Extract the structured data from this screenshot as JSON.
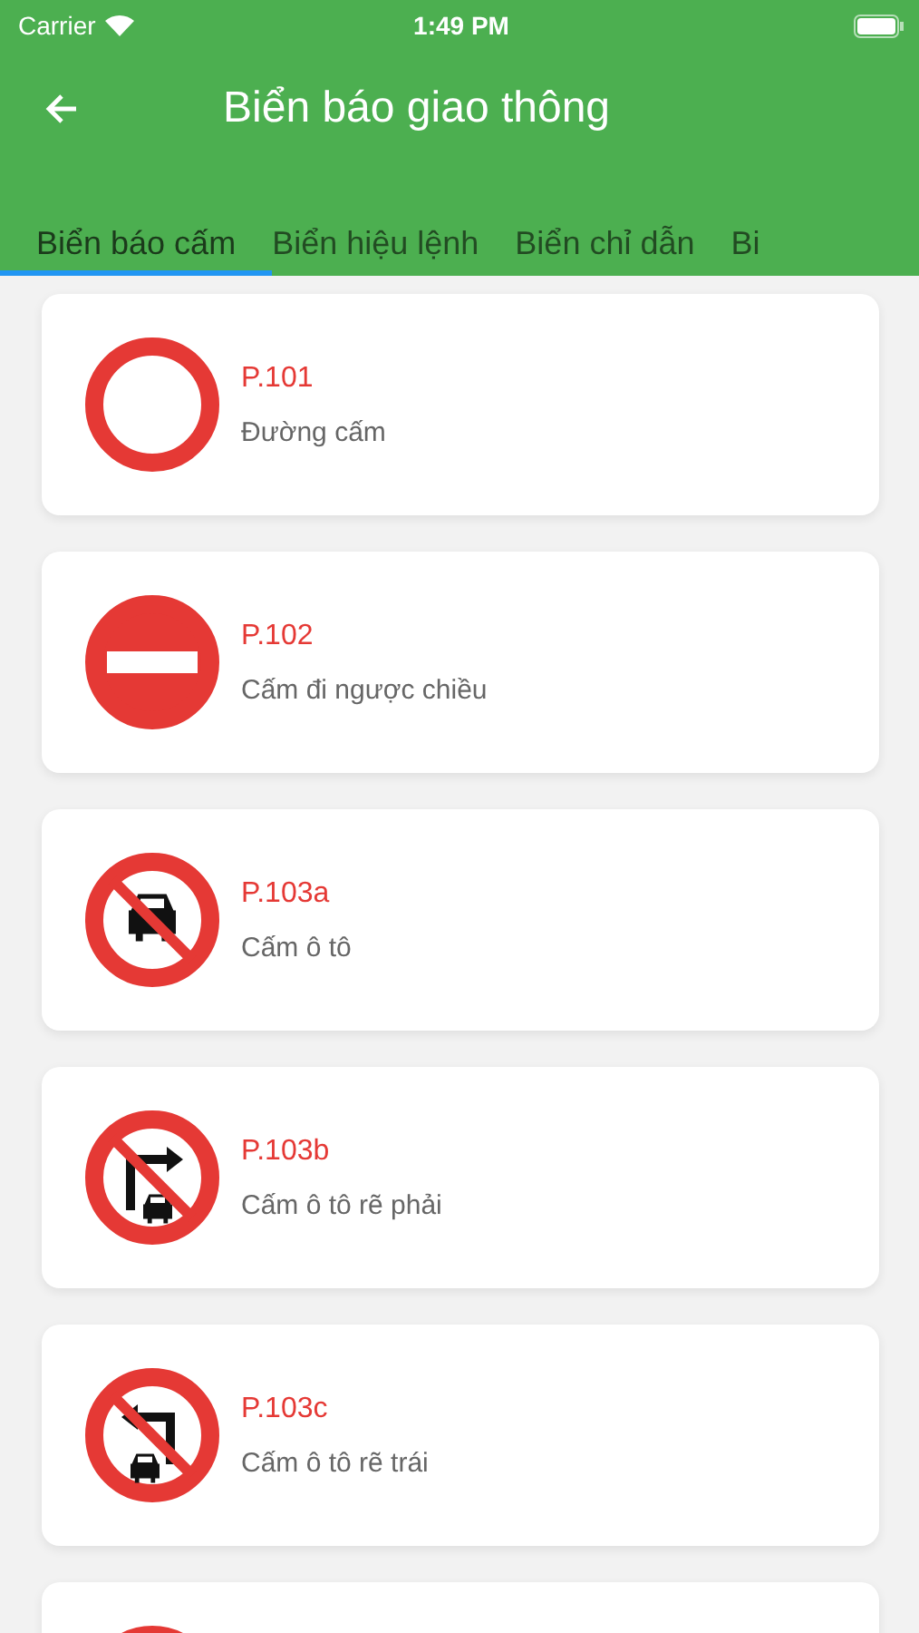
{
  "status_bar": {
    "carrier": "Carrier",
    "time": "1:49 PM"
  },
  "app_bar": {
    "title": "Biển báo giao thông"
  },
  "tabs": [
    {
      "label": "Biển báo cấm",
      "selected": true
    },
    {
      "label": "Biển hiệu lệnh",
      "selected": false
    },
    {
      "label": "Biển chỉ dẫn",
      "selected": false
    },
    {
      "label": "Bi",
      "selected": false
    }
  ],
  "signs": [
    {
      "kind": "no-entry-ring",
      "code": "P.101",
      "name": "Đường cấm"
    },
    {
      "kind": "no-entry-bar",
      "code": "P.102",
      "name": "Cấm đi ngược chiều"
    },
    {
      "kind": "no-car",
      "code": "P.103a",
      "name": "Cấm ô tô"
    },
    {
      "kind": "no-right-turn",
      "code": "P.103b",
      "name": "Cấm ô tô rẽ phải"
    },
    {
      "kind": "no-left-turn",
      "code": "P.103c",
      "name": "Cấm ô tô rẽ trái"
    },
    {
      "kind": "no-entry-ring"
    }
  ]
}
